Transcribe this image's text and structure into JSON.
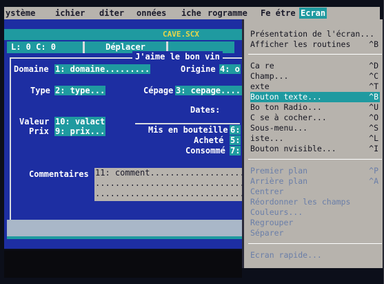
{
  "menubar": {
    "items": [
      "ystème",
      "ichier",
      "diter",
      "onnées",
      "iche",
      "rogramme",
      "Fe étre",
      "Ecran"
    ],
    "active": "Ecran"
  },
  "window": {
    "title": "CAVE.SCX",
    "coords": "L: 0 C: 0",
    "mode": "Déplacer"
  },
  "form": {
    "title": "J'aime le bon vin",
    "domaine": {
      "label": "Domaine",
      "field": "1: domaine........."
    },
    "origine": {
      "label": "Origine",
      "field": "4: o"
    },
    "type": {
      "label": "Type",
      "field": "2: type..."
    },
    "cepage": {
      "label": "Cépage",
      "field": "3: cepage....."
    },
    "dates": {
      "label": "Dates:"
    },
    "valeur": {
      "label": "Valeur",
      "field": "10: valact"
    },
    "prix": {
      "label": "Prix",
      "field": "9: prix..."
    },
    "mis_en_bouteille": {
      "label": "Mis en bouteille",
      "field": "6:"
    },
    "achete": {
      "label": "Acheté",
      "field": "5:"
    },
    "consomme": {
      "label": "Consommé",
      "field": "7:"
    },
    "commentaires": {
      "label": "Commentaires",
      "lines": [
        "11: comment....................",
        "...............................",
        "..............................."
      ]
    }
  },
  "ecran_menu": {
    "group1": [
      {
        "label": "Présentation de l'écran...",
        "shortcut": ""
      },
      {
        "label": "Afficher les routines",
        "shortcut": "^B"
      }
    ],
    "group2": [
      {
        "label": "Ca re",
        "shortcut": "^D"
      },
      {
        "label": "Champ...",
        "shortcut": "^C"
      },
      {
        "label": "exte",
        "shortcut": "^T"
      },
      {
        "label": "Bouton texte...",
        "shortcut": "^B",
        "selected": true
      },
      {
        "label": "Bo ton Radio...",
        "shortcut": "^U"
      },
      {
        "label": "C se à cocher...",
        "shortcut": "^O"
      },
      {
        "label": "Sous-menu...",
        "shortcut": "^S"
      },
      {
        "label": "iste...",
        "shortcut": "^L"
      },
      {
        "label": "Bouton nvisible...",
        "shortcut": "^I"
      }
    ],
    "group3": [
      {
        "label": "Premier plan",
        "shortcut": "^P"
      },
      {
        "label": "Arrière plan",
        "shortcut": "^A"
      },
      {
        "label": "Centrer",
        "shortcut": ""
      },
      {
        "label": "Réordonner les champs",
        "shortcut": ""
      },
      {
        "label": "Couleurs...",
        "shortcut": ""
      },
      {
        "label": "Regrouper",
        "shortcut": ""
      },
      {
        "label": "Séparer",
        "shortcut": ""
      }
    ],
    "group4": [
      {
        "label": "Ecran rapide...",
        "shortcut": ""
      }
    ]
  },
  "footer": {
    "arrow": "◄►"
  },
  "colors": {
    "desk_blue": "#1d2ea2",
    "teal": "#1f9aa0",
    "menu_grey": "#b7b3ad",
    "title_yellow": "#e8d64a",
    "disabled_text": "#6a7ea8"
  }
}
